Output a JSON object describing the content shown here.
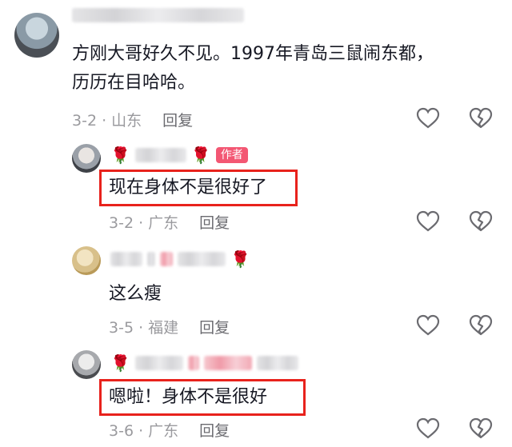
{
  "comments": [
    {
      "text_line1": "方刚大哥好久不见。1997年青岛三鼠闹东都，",
      "text_line2": "历历在目哈哈。",
      "meta": "3-2 · 山东",
      "reply_label": "回复"
    },
    {
      "author_tag": "作者",
      "text": "现在身体不是很好了",
      "meta": "3-2 · 广东",
      "reply_label": "回复"
    },
    {
      "text": "这么瘦",
      "meta": "3-5 · 福建",
      "reply_label": "回复"
    },
    {
      "text": "嗯啦！身体不是很好",
      "meta": "3-6 · 广东",
      "reply_label": "回复"
    }
  ],
  "icons": {
    "like": "heart-outline-icon",
    "dislike": "broken-heart-icon",
    "rose": "rose-emoji"
  },
  "colors": {
    "highlight": "#e8221c",
    "author_tag_bg": "#f35773",
    "meta_text": "#9a9a9e"
  }
}
